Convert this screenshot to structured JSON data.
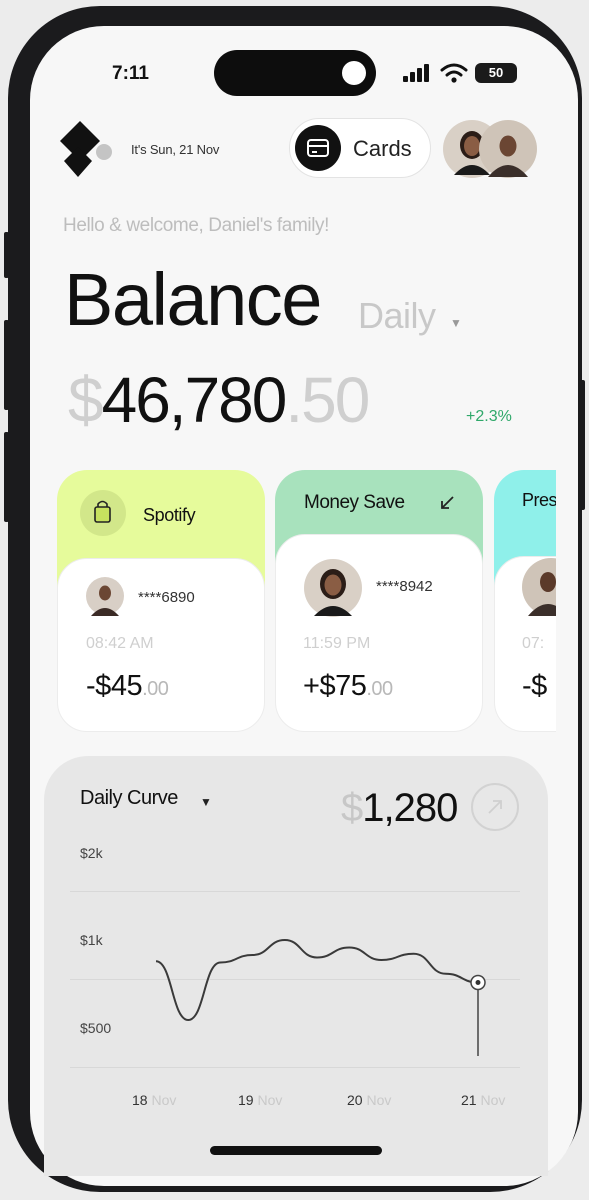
{
  "status_bar": {
    "time": "7:11",
    "battery": "50"
  },
  "header": {
    "date": "It's Sun, 21 Nov",
    "cards_label": "Cards"
  },
  "welcome": "Hello & welcome, Daniel's family!",
  "balance": {
    "title": "Balance",
    "period": "Daily",
    "currency": "$",
    "whole": "46,780",
    "cents": ".50",
    "change": "+2.3%"
  },
  "transactions": [
    {
      "name": "Spotify",
      "account": "****6890",
      "time": "08:42 AM",
      "sign": "-",
      "currency": "$",
      "amount": "45",
      "cents": ".00",
      "color": "#e6fb9b"
    },
    {
      "name": "Money Save",
      "account": "****8942",
      "time": "11:59 PM",
      "sign": "+",
      "currency": "$",
      "amount": "75",
      "cents": ".00",
      "color": "#a8e2bd"
    },
    {
      "name": "Pres",
      "account": "",
      "time": "07:",
      "sign": "-",
      "currency": "$",
      "amount": "",
      "cents": "",
      "color": "#8ff0ea"
    }
  ],
  "daily_curve": {
    "title": "Daily Curve",
    "currency": "$",
    "amount": "1,280",
    "y_labels": [
      "$2k",
      "$1k",
      "$500"
    ],
    "x_labels": [
      {
        "day": "18",
        "month": "Nov"
      },
      {
        "day": "19",
        "month": "Nov"
      },
      {
        "day": "20",
        "month": "Nov"
      },
      {
        "day": "21",
        "month": "Nov"
      }
    ]
  },
  "chart_data": {
    "type": "line",
    "x": [
      "18 Nov",
      "19 Nov",
      "20 Nov",
      "21 Nov"
    ],
    "y_ticks": [
      "$2k",
      "$1k",
      "$500"
    ],
    "series": [
      {
        "values": [
          950,
          480,
          940,
          1000,
          1120,
          980,
          1060,
          960,
          1010,
          850,
          780
        ]
      }
    ],
    "ylim": [
      0,
      2000
    ]
  },
  "icons": {
    "logo": "app-logo-icon",
    "signal": "signal-icon",
    "wifi": "wifi-icon",
    "card": "credit-card-icon",
    "spotify": "shopping-bag-icon",
    "arrow": "arrow-down-left-icon",
    "expand": "arrow-up-right-icon"
  }
}
